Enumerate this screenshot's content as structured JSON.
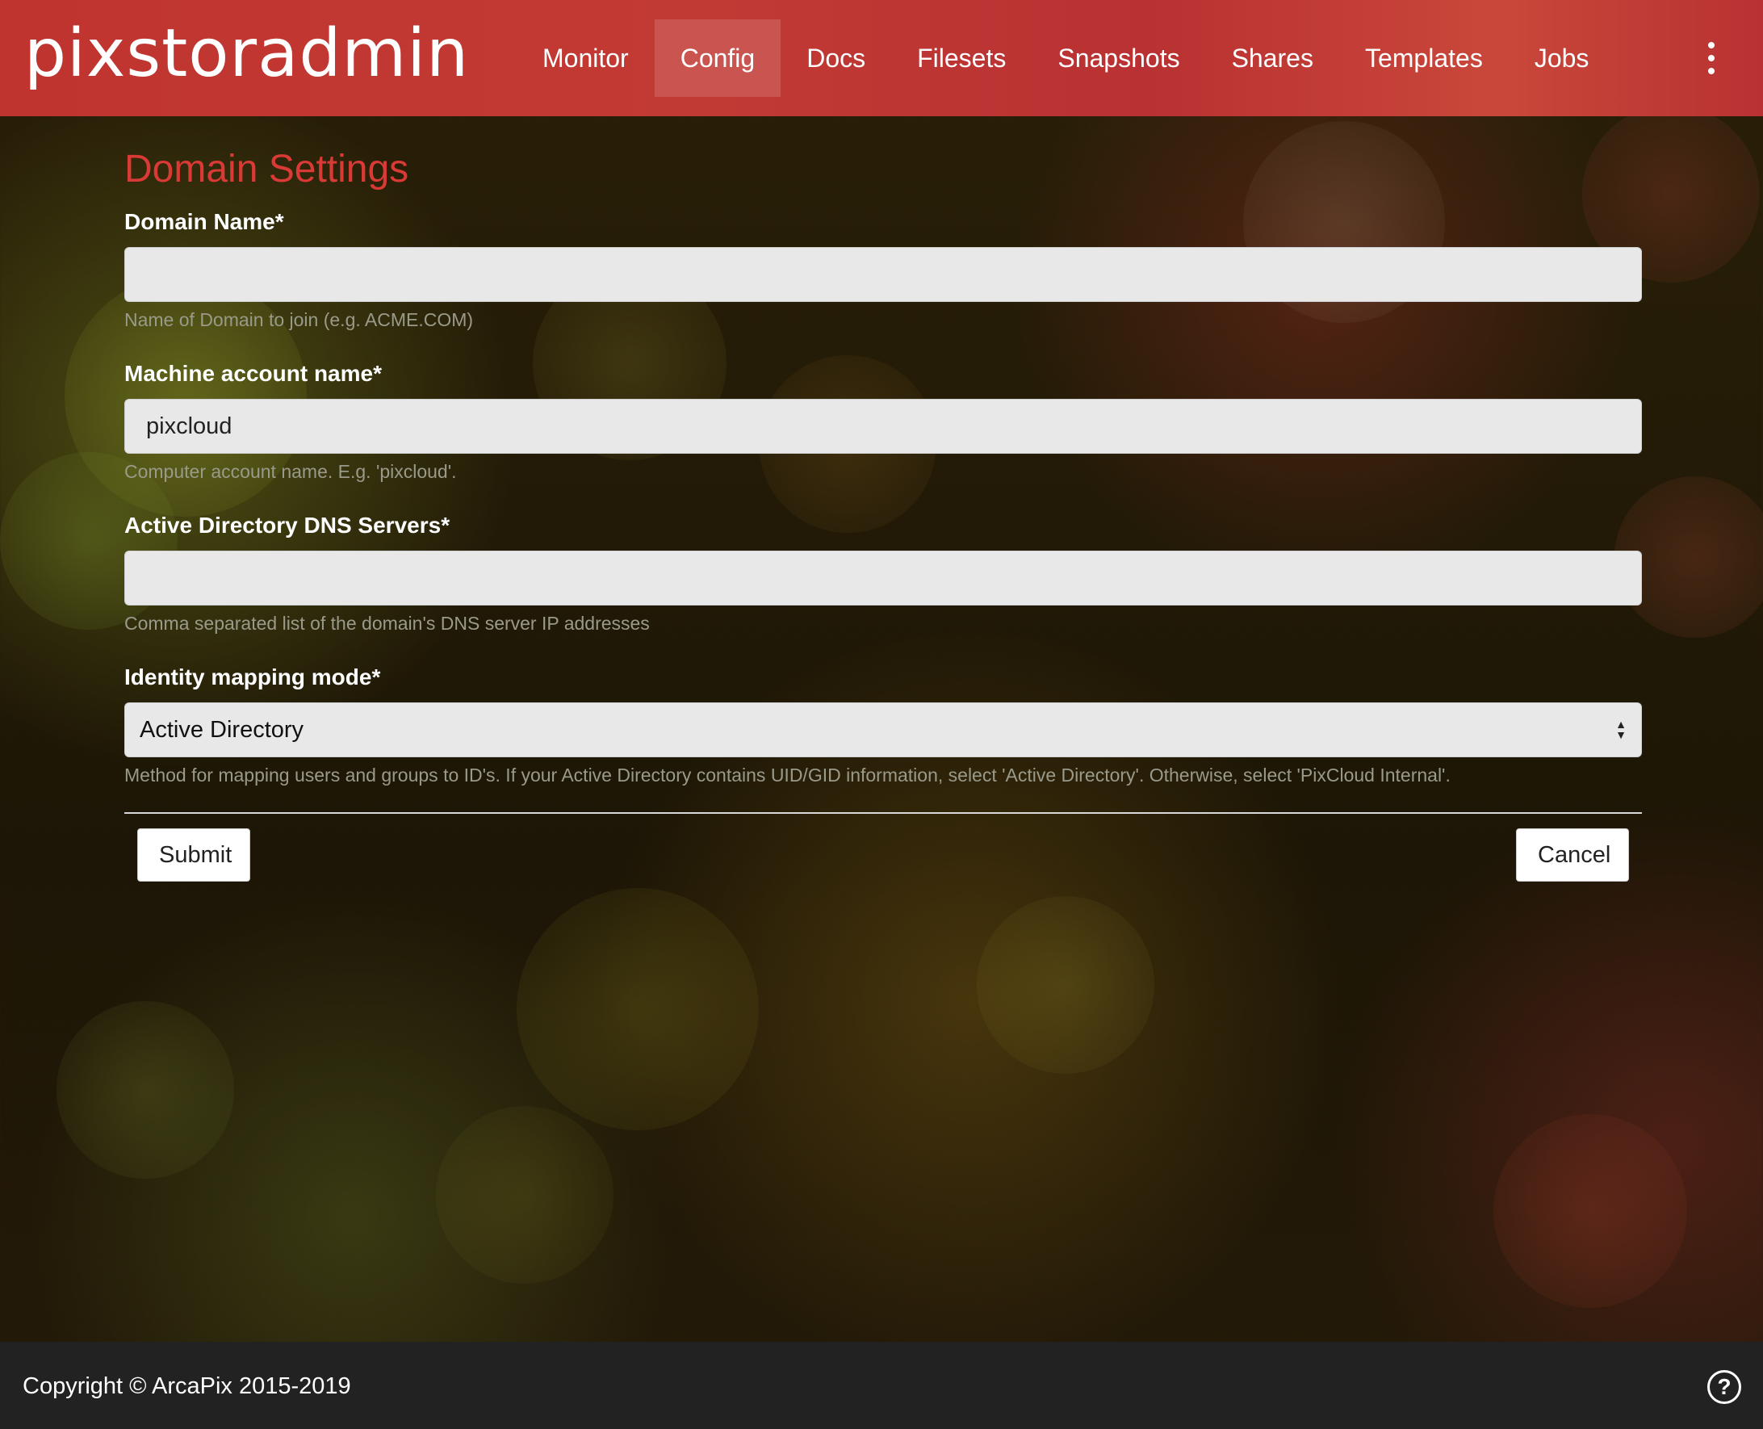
{
  "app": {
    "logo": "pixstoradmin"
  },
  "nav": {
    "items": [
      {
        "label": "Monitor"
      },
      {
        "label": "Config",
        "active": true
      },
      {
        "label": "Docs"
      },
      {
        "label": "Filesets"
      },
      {
        "label": "Snapshots"
      },
      {
        "label": "Shares"
      },
      {
        "label": "Templates"
      },
      {
        "label": "Jobs"
      }
    ],
    "more_icon": "kebab-menu-icon"
  },
  "form": {
    "title": "Domain Settings",
    "domain_name": {
      "label": "Domain Name*",
      "value": "",
      "help": "Name of Domain to join (e.g. ACME.COM)"
    },
    "machine_account": {
      "label": "Machine account name*",
      "value": "pixcloud",
      "help": "Computer account name. E.g. 'pixcloud'."
    },
    "dns_servers": {
      "label": "Active Directory DNS Servers*",
      "value": "",
      "help": "Comma separated list of the domain's DNS server IP addresses"
    },
    "identity_mapping": {
      "label": "Identity mapping mode*",
      "selected": "Active Directory",
      "help": "Method for mapping users and groups to ID's. If your Active Directory contains UID/GID information, select 'Active Directory'. Otherwise, select 'PixCloud Internal'."
    },
    "submit_label": "Submit",
    "cancel_label": "Cancel"
  },
  "footer": {
    "copyright": "Copyright © ArcaPix 2015-2019",
    "help_icon": "question-circle-icon"
  },
  "colors": {
    "header_red": "#c0342f",
    "title_red": "#d93a35",
    "footer_bg": "#222222"
  }
}
